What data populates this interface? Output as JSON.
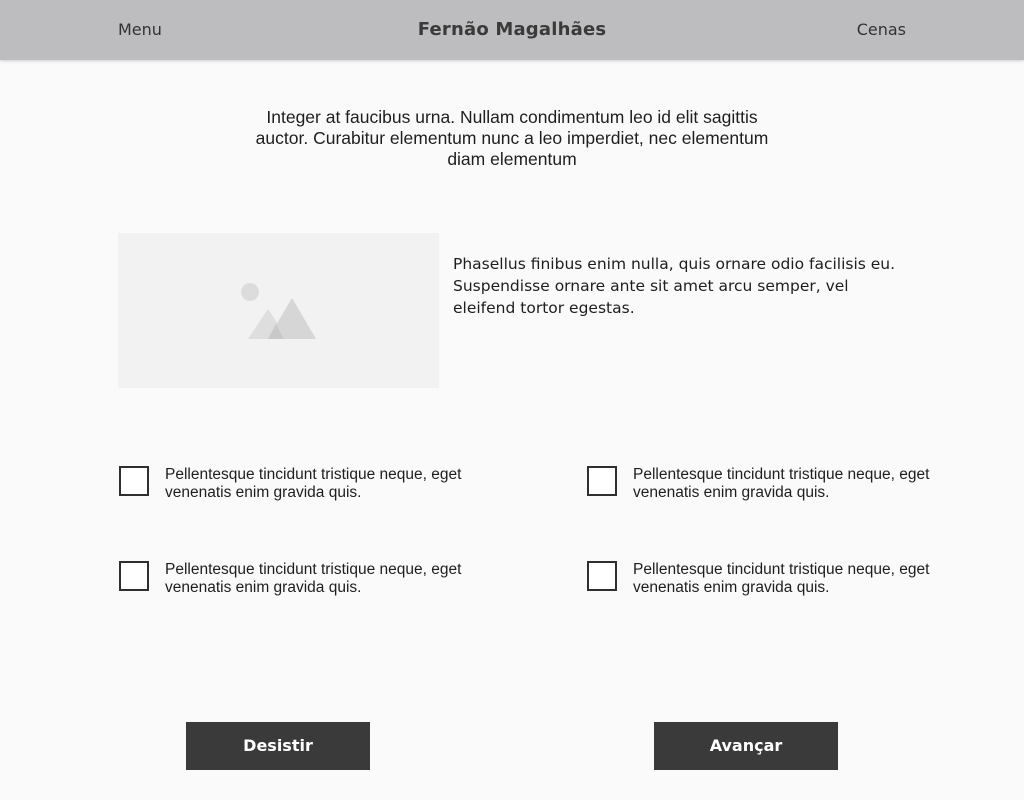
{
  "header": {
    "menu_label": "Menu",
    "title": "Fernão Magalhães",
    "scenes_label": "Cenas"
  },
  "intro": {
    "text": "Integer at faucibus urna. Nullam condimentum leo id elit sagittis auctor. Curabitur elementum nunc a leo imperdiet, nec elementum diam elementum"
  },
  "media": {
    "image_icon": "image-placeholder-icon",
    "description": "Phasellus finibus enim nulla, quis ornare odio facilisis eu. Suspendisse ornare ante sit amet arcu semper, vel eleifend tortor egestas."
  },
  "options": [
    {
      "label": "Pellentesque tincidunt tristique neque, eget venenatis enim gravida quis.",
      "checked": false
    },
    {
      "label": "Pellentesque tincidunt tristique neque, eget venenatis enim gravida quis.",
      "checked": false
    },
    {
      "label": "Pellentesque tincidunt tristique neque, eget venenatis enim gravida quis.",
      "checked": false
    },
    {
      "label": "Pellentesque tincidunt tristique neque, eget venenatis enim gravida quis.",
      "checked": false
    }
  ],
  "actions": {
    "quit_label": "Desistir",
    "next_label": "Avançar"
  },
  "colors": {
    "header_bg": "#bdbdbf",
    "page_bg": "#fafafa",
    "button_bg": "#3a3a3a",
    "placeholder_bg": "#f2f2f2"
  }
}
